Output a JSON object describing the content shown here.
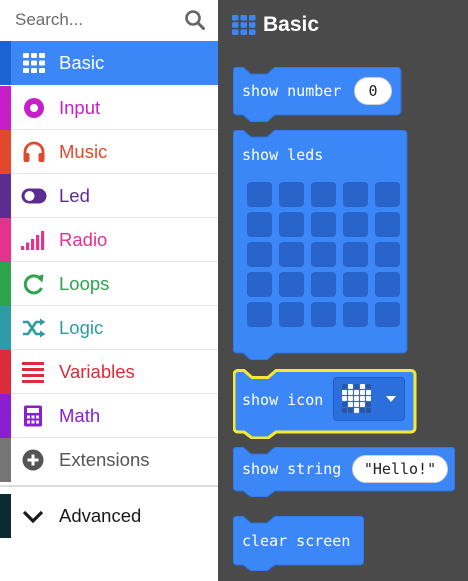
{
  "search": {
    "placeholder": "Search..."
  },
  "toolbox": {
    "categories": [
      {
        "label": "Basic",
        "color": "#3c87f7",
        "icon": "grid-icon",
        "selected": true
      },
      {
        "label": "Input",
        "color": "#c71fc7",
        "icon": "target-icon"
      },
      {
        "label": "Music",
        "color": "#e04a2b",
        "icon": "headphones-icon"
      },
      {
        "label": "Led",
        "color": "#5c2d91",
        "icon": "toggle-icon"
      },
      {
        "label": "Radio",
        "color": "#e3338c",
        "icon": "signal-bars-icon"
      },
      {
        "label": "Loops",
        "color": "#2ea44f",
        "icon": "refresh-icon"
      },
      {
        "label": "Logic",
        "color": "#2d9ba6",
        "icon": "shuffle-icon"
      },
      {
        "label": "Variables",
        "color": "#dc2b3b",
        "icon": "list-icon"
      },
      {
        "label": "Math",
        "color": "#8a1fd2",
        "icon": "calculator-icon"
      },
      {
        "label": "Extensions",
        "color": "#757575",
        "icon": "plus-circle-icon"
      },
      {
        "label": "Advanced",
        "color": "#0b2b33",
        "icon": "chevron-down-icon"
      }
    ]
  },
  "flyout": {
    "title": "Basic",
    "accent": "#3c87f7",
    "blocks": {
      "show_number": {
        "label": "show number",
        "value": "0"
      },
      "show_leds": {
        "label": "show leds"
      },
      "show_icon": {
        "label": "show icon"
      },
      "show_string": {
        "label": "show string",
        "value": "\"Hello!\""
      },
      "clear_screen": {
        "label": "clear screen"
      }
    }
  }
}
